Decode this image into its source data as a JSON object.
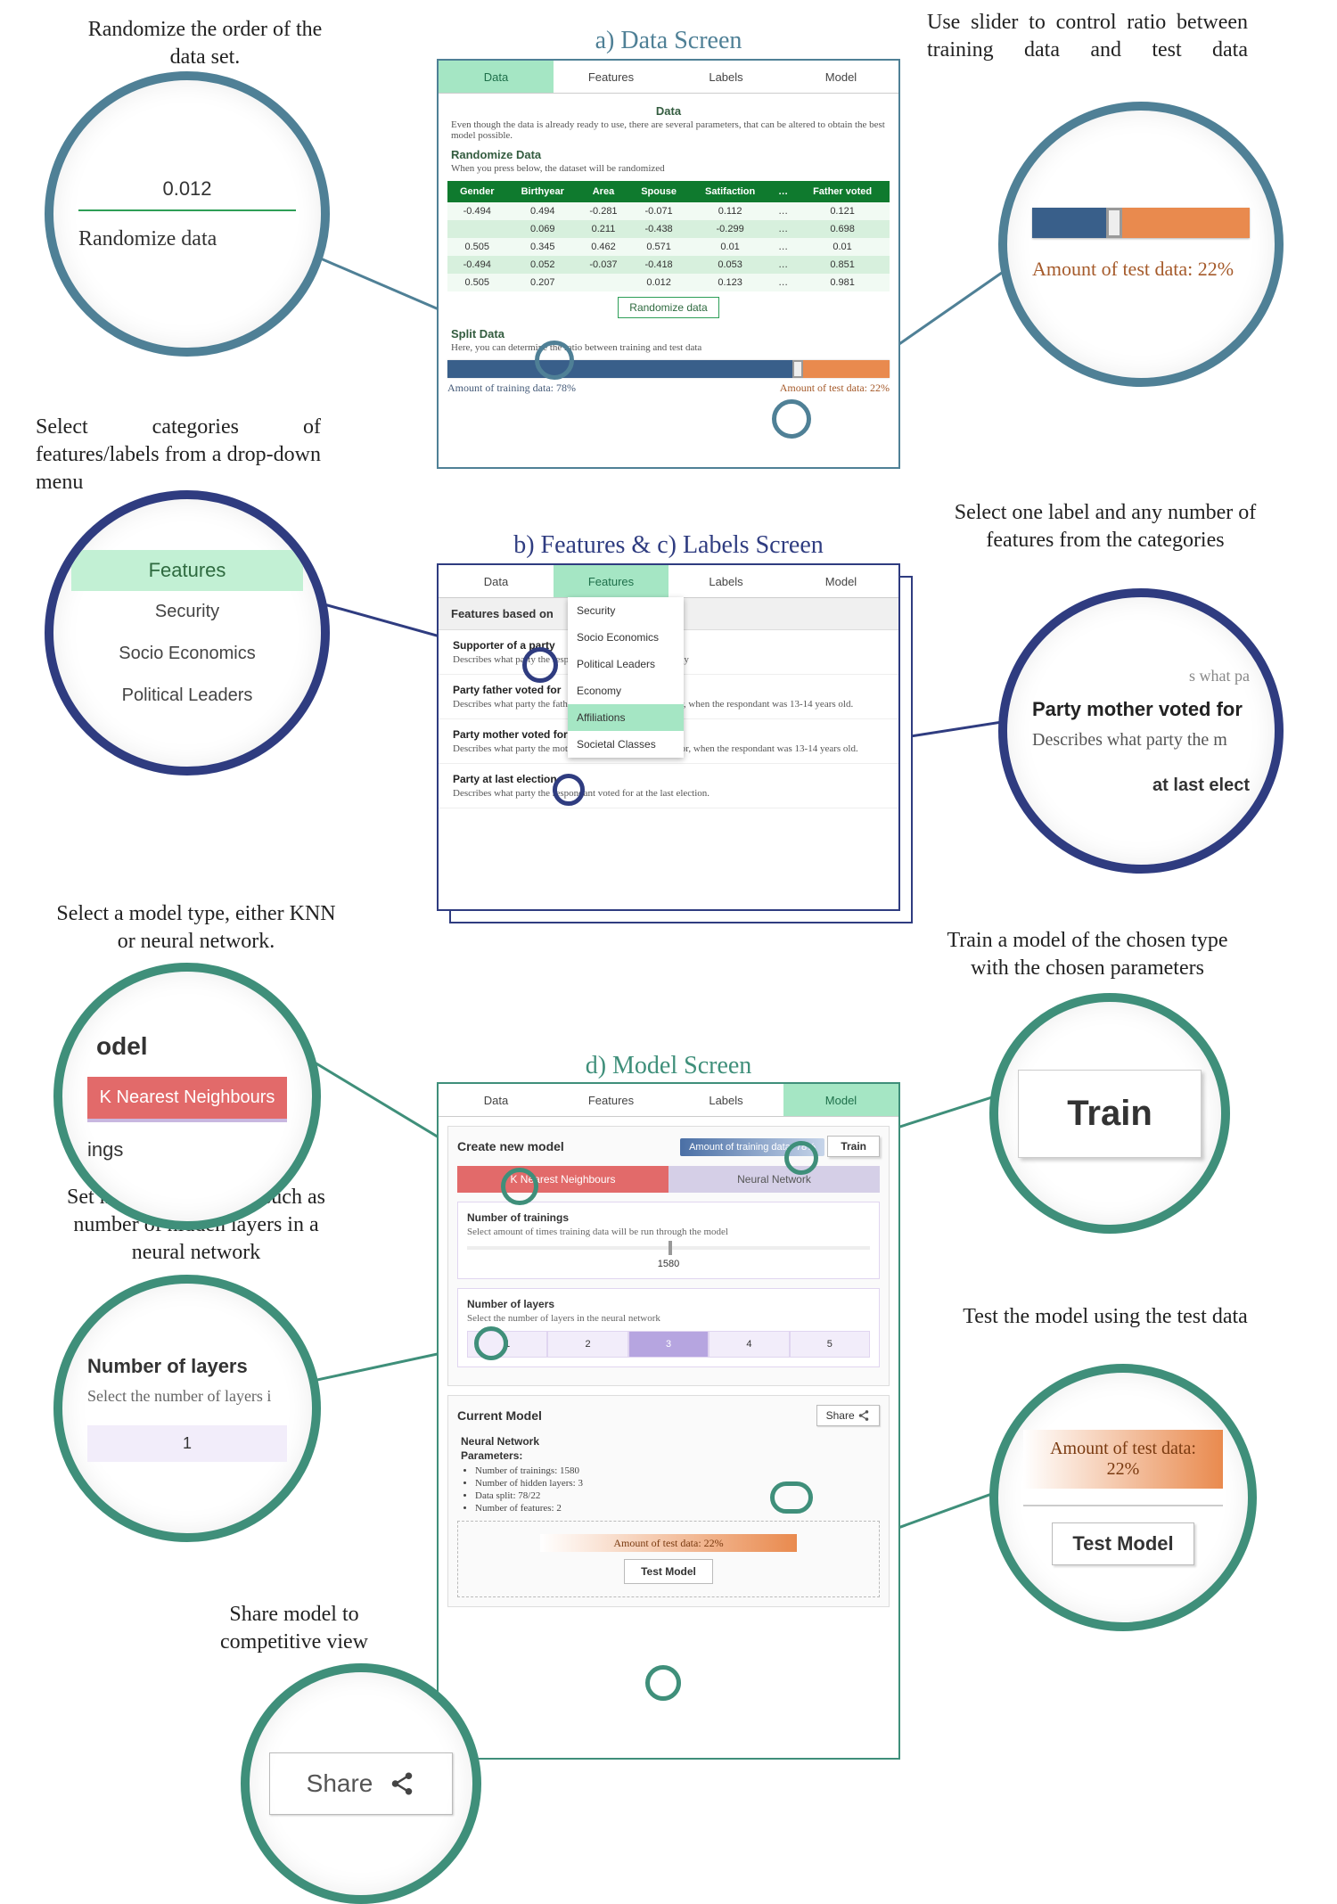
{
  "captions": {
    "randomize": "Randomize the order of the data set.",
    "slider": "Use slider to control ratio between training data and test data",
    "dropdown": "Select categories of features/labels from a drop-down menu",
    "pick_feature": "Select one label and any number of features from the categories",
    "model_type": "Select a model type, either KNN or neural network.",
    "train": "Train a model of the chosen type with the chosen parameters",
    "params": "Set model parameters, such as number of hidden layers in a neural network",
    "test": "Test the model using the test data",
    "share": "Share model to competitive view"
  },
  "titles": {
    "a": "a) Data Screen",
    "bc": "b) Features & c) Labels  Screen",
    "d": "d) Model Screen"
  },
  "tabs": [
    "Data",
    "Features",
    "Labels",
    "Model"
  ],
  "data_screen": {
    "h": "Data",
    "p": "Even though the data is already ready to use, there are several parameters, that can be altered to obtain the best model possible.",
    "rand_h": "Randomize Data",
    "rand_p": "When you press below, the dataset will be randomized",
    "cols": [
      "Gender",
      "Birthyear",
      "Area",
      "Spouse",
      "Satifaction",
      "…",
      "Father voted"
    ],
    "rows": [
      [
        "-0.494",
        "0.494",
        "-0.281",
        "-0.071",
        "0.112",
        "…",
        "0.121"
      ],
      [
        "",
        "0.069",
        "0.211",
        "-0.438",
        "-0.299",
        "…",
        "0.698"
      ],
      [
        "0.505",
        "0.345",
        "0.462",
        "0.571",
        "0.01",
        "…",
        "0.01"
      ],
      [
        "-0.494",
        "0.052",
        "-0.037",
        "-0.418",
        "0.053",
        "…",
        "0.851"
      ],
      [
        "0.505",
        "0.207",
        "",
        "0.012",
        "0.123",
        "…",
        "0.981"
      ]
    ],
    "rand_btn": "Randomize data",
    "split_h": "Split Data",
    "split_p": "Here, you can determine the ratio between training and test data",
    "train_lbl": "Amount of training data: 78%",
    "test_lbl": "Amount of test data: 22%"
  },
  "features_screen": {
    "head": "Features based on",
    "dd": [
      "Security",
      "Socio Economics",
      "Political Leaders",
      "Economy",
      "Affiliations",
      "Societal Classes"
    ],
    "dd_selected": "Affiliations",
    "items": [
      {
        "t": "Supporter of a party",
        "d": "Describes what party the respondent is a supporter of, if any"
      },
      {
        "t": "Party father voted for",
        "d": "Describes what party the father of the respondent voted for, when the respondant was 13-14 years old."
      },
      {
        "t": "Party mother voted for",
        "d": "Describes what party the mother of the respondant voted for, when the respondant was 13-14 years old."
      },
      {
        "t": "Party at last election",
        "d": "Describes what party the respondant voted for at the last election."
      }
    ]
  },
  "model_screen": {
    "create_h": "Create new model",
    "train_info": "Amount of training data: 78%",
    "train_btn": "Train",
    "types": {
      "knn": "K Nearest Neighbours",
      "nn": "Neural Network"
    },
    "p1_h": "Number of trainings",
    "p1_d": "Select amount of times training data will be run through the model",
    "p1_val": "1580",
    "p2_h": "Number of layers",
    "p2_d": "Select the number of layers in the neural network",
    "layers": [
      "1",
      "2",
      "3",
      "4",
      "5"
    ],
    "layers_sel": "3",
    "cur_h": "Current Model",
    "share": "Share",
    "cur_type": "Neural Network",
    "params_h": "Parameters:",
    "params": [
      "Number of trainings: 1580",
      "Number of hidden layers: 3",
      "Data split: 78/22",
      "Number of features: 2"
    ],
    "test_bar": "Amount of test data: 22%",
    "test_btn": "Test Model"
  },
  "circles": {
    "randomize": {
      "num": "0.012",
      "btn": "Randomize data"
    },
    "slider": {
      "label": "Amount of test data: 22%"
    },
    "dd": {
      "head": "Features",
      "items": [
        "Security",
        "Socio Economics",
        "Political Leaders"
      ]
    },
    "feature": {
      "t": "Party mother voted for",
      "d": "Describes what party the m",
      "frag1": "s what pa",
      "frag2": "at last elect"
    },
    "model": {
      "head_frag": "odel",
      "btn": "K Nearest Neighbours",
      "frag2": "ings"
    },
    "layers": {
      "h": "Number of layers",
      "d": "Select the number of layers i",
      "v": "1"
    },
    "train": "Train",
    "share": "Share",
    "test": {
      "bar": "Amount of test data: 22%",
      "btn": "Test Model"
    }
  }
}
